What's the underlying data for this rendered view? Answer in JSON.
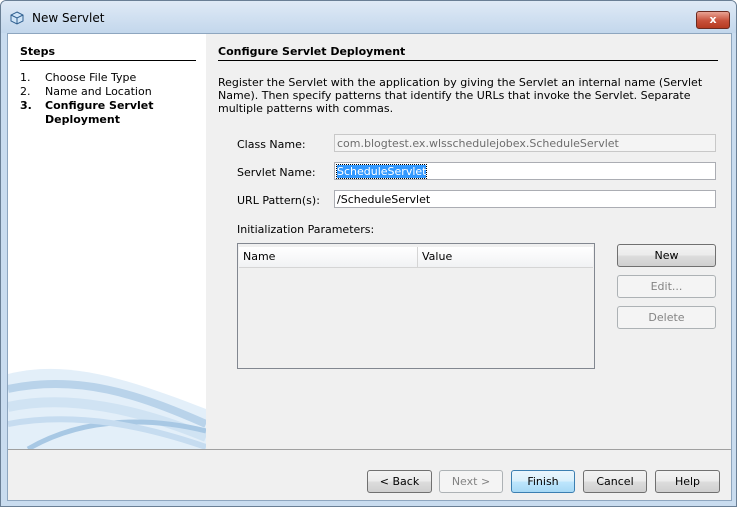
{
  "window": {
    "title": "New Servlet",
    "close_label": "x"
  },
  "steps": {
    "heading": "Steps",
    "items": [
      {
        "num": "1.",
        "label": "Choose File Type"
      },
      {
        "num": "2.",
        "label": "Name and Location"
      },
      {
        "num": "3.",
        "label": "Configure Servlet Deployment",
        "current": true
      }
    ]
  },
  "panel": {
    "title": "Configure Servlet Deployment",
    "description": "Register the Servlet with the application by giving the Servlet an internal name (Servlet Name). Then specify patterns that identify the URLs that invoke the Servlet. Separate multiple patterns with commas.",
    "class_name": {
      "label": "Class Name:",
      "value": "com.blogtest.ex.wlsschedulejobex.ScheduleServlet"
    },
    "servlet_name": {
      "label": "Servlet Name:",
      "value": "ScheduleServlet"
    },
    "url_pattern": {
      "label": "URL Pattern(s):",
      "value": "/ScheduleServlet"
    },
    "init_params": {
      "label": "Initialization Parameters:",
      "columns": [
        "Name",
        "Value"
      ],
      "rows": []
    },
    "param_buttons": {
      "new": "New",
      "edit": "Edit...",
      "delete": "Delete"
    }
  },
  "buttons": {
    "back": "< Back",
    "next": "Next >",
    "finish": "Finish",
    "cancel": "Cancel",
    "help": "Help"
  }
}
